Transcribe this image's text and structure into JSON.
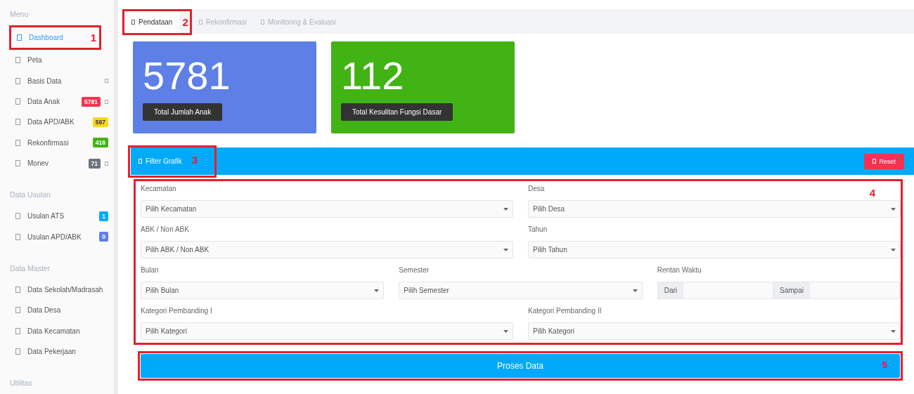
{
  "sidebar": {
    "sections": [
      {
        "title": "Menu",
        "items": [
          {
            "label": "Dashboard",
            "selected": true,
            "submenu": false,
            "annotation": "1"
          },
          {
            "label": "Peta",
            "selected": false,
            "submenu": false
          },
          {
            "label": "Basis Data",
            "selected": false,
            "submenu": true
          },
          {
            "label": "Data Anak",
            "selected": false,
            "submenu": true,
            "badge": {
              "text": "5781",
              "color": "#f5334f"
            }
          },
          {
            "label": "Data APD/ABK",
            "selected": false,
            "submenu": false,
            "badge": {
              "text": "597",
              "color": "#f7d71c"
            }
          },
          {
            "label": "Rekonfirmasi",
            "selected": false,
            "submenu": false,
            "badge": {
              "text": "416",
              "color": "#41b314"
            }
          },
          {
            "label": "Monev",
            "selected": false,
            "submenu": true,
            "badge": {
              "text": "71",
              "color": "#6c757d"
            }
          }
        ]
      },
      {
        "title": "Data Usulan",
        "items": [
          {
            "label": "Usulan ATS",
            "selected": false,
            "submenu": false,
            "badge": {
              "text": "1",
              "color": "#00a9f9"
            }
          },
          {
            "label": "Usulan APD/ABK",
            "selected": false,
            "submenu": false,
            "badge": {
              "text": "0",
              "color": "#5d7fe6"
            }
          }
        ]
      },
      {
        "title": "Data Master",
        "items": [
          {
            "label": "Data Sekolah/Madrasah",
            "selected": false,
            "submenu": false
          },
          {
            "label": "Data Desa",
            "selected": false,
            "submenu": false
          },
          {
            "label": "Data Kecamatan",
            "selected": false,
            "submenu": false
          },
          {
            "label": "Data Pekerjaan",
            "selected": false,
            "submenu": false
          }
        ]
      },
      {
        "title": "Utilitas"
      }
    ]
  },
  "tabs": [
    {
      "label": "Pendataan",
      "selected": true,
      "annotation": "2"
    },
    {
      "label": "Rekonfirmasi",
      "selected": false
    },
    {
      "label": "Monitoring & Evaluasi",
      "selected": false
    }
  ],
  "stat_cards": [
    {
      "value": "5781",
      "label": "Total Jumlah Anak",
      "color": "#5d7fe6"
    },
    {
      "value": "112",
      "label": "Total Kesulitan Fungsi Dasar",
      "color": "#41b314"
    }
  ],
  "filter": {
    "title": "Filter Grafik",
    "title_annotation": "3",
    "reset_button": "Reset",
    "form_annotation": "4",
    "rows": [
      {
        "fields": [
          {
            "kind": "select",
            "label": "Kecamatan",
            "placeholder": "Pilih Kecamatan"
          },
          {
            "kind": "select",
            "label": "Desa",
            "placeholder": "Pilih Desa"
          }
        ]
      },
      {
        "fields": [
          {
            "kind": "select",
            "label": "ABK / Non ABK",
            "placeholder": "Pilih ABK / Non ABK"
          },
          {
            "kind": "select",
            "label": "Tahun",
            "placeholder": "Pilih Tahun"
          }
        ]
      },
      {
        "fields": [
          {
            "kind": "select",
            "label": "Bulan",
            "placeholder": "Pilih Bulan"
          },
          {
            "kind": "select",
            "label": "Semester",
            "placeholder": "Pilih Semester"
          },
          {
            "kind": "range",
            "label": "Rentan Waktu",
            "from": "Dari",
            "to": "Sampai"
          }
        ]
      },
      {
        "fields": [
          {
            "kind": "select",
            "label": "Kategori Pembanding I",
            "placeholder": "Pilih Kategori"
          },
          {
            "kind": "select",
            "label": "Kategori Pembanding II",
            "placeholder": "Pilih Kategori"
          }
        ]
      }
    ],
    "submit_button": "Proses Data",
    "submit_annotation": "5"
  }
}
